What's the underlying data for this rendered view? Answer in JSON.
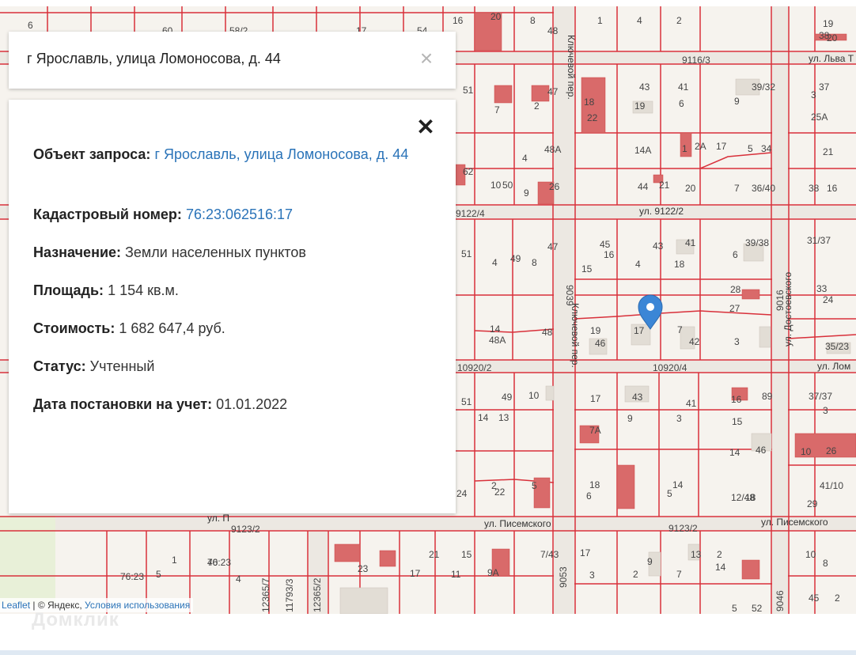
{
  "search": {
    "query": "г Ярославль, улица Ломоносова, д. 44",
    "clear_icon": "×"
  },
  "info": {
    "close_icon": "✕",
    "object_label": "Объект запроса:",
    "object_value": "г Ярославль, улица Ломоносова, д. 44",
    "cadastral_label": "Кадастровый номер:",
    "cadastral_value": "76:23:062516:17",
    "purpose_label": "Назначение:",
    "purpose_value": "Земли населенных пунктов",
    "area_label": "Площадь:",
    "area_value": "1 154 кв.м.",
    "cost_label": "Стоимость:",
    "cost_value": "1 682 647,4 руб.",
    "status_label": "Статус:",
    "status_value": "Учтенный",
    "date_label": "Дата постановки на учет:",
    "date_value": "01.01.2022"
  },
  "map": {
    "streets": {
      "lva_tolstogo": "ул. Льва Т",
      "ul_9122": "ул. 9122/2",
      "lomonosova": "ул. Лом",
      "pisemskogo_1": "ул. Писемского",
      "pisemskogo_2": "ул. Писемского",
      "pisemskogo_3": "ул. П",
      "klyuchevoy_1": "Ключевой пер.",
      "klyuchevoy_2": "Ключевой пер.",
      "dostoevskogo": "ул. Достоевского"
    },
    "codes": [
      "9116/3",
      "9122/4",
      "10920/2",
      "10920/4",
      "9123/2",
      "9123/2",
      "9039",
      "9016",
      "9053",
      "9046",
      "12365/7",
      "11793/3",
      "12365/2",
      "76:23"
    ],
    "house_numbers": [
      "6",
      "60",
      "58/2",
      "17",
      "54",
      "16",
      "20",
      "8",
      "48",
      "1",
      "4",
      "2",
      "19",
      "38",
      "20",
      "43",
      "41",
      "39/32",
      "37",
      "51",
      "7",
      "2",
      "47",
      "18",
      "22",
      "19",
      "6",
      "9",
      "3",
      "25А",
      "48А",
      "4",
      "14А",
      "1",
      "2А",
      "17",
      "5",
      "34",
      "21",
      "62",
      "10",
      "50",
      "9",
      "26",
      "44",
      "21",
      "20",
      "7",
      "36/40",
      "38",
      "16",
      "45",
      "16",
      "43",
      "41",
      "39/38",
      "31/37",
      "51",
      "4",
      "49",
      "8",
      "47",
      "15",
      "4",
      "18",
      "6",
      "28",
      "33",
      "24",
      "27",
      "14",
      "48А",
      "48",
      "19",
      "46",
      "17",
      "7",
      "42",
      "3",
      "35/23",
      "51",
      "49",
      "14",
      "13",
      "10",
      "17",
      "43",
      "41",
      "16",
      "89",
      "37/37",
      "3",
      "15",
      "7А",
      "9",
      "3",
      "14",
      "46",
      "10",
      "26",
      "24",
      "2",
      "22",
      "5",
      "18",
      "6",
      "14",
      "5",
      "12/48",
      "18",
      "41/10",
      "29",
      "1",
      "5",
      "76:23",
      "40",
      "4",
      "23",
      "21",
      "17",
      "15",
      "11",
      "9А",
      "7/43",
      "17",
      "3",
      "2",
      "9",
      "7",
      "13",
      "2",
      "14",
      "10",
      "8",
      "5",
      "52",
      "45",
      "2"
    ],
    "marker_icon": "map-pin"
  },
  "attribution": {
    "leaflet": "Leaflet",
    "separator": " | © Яндекс, ",
    "terms": "Условия использования"
  },
  "watermark": "Домклик",
  "colors": {
    "boundary": "#d8303a",
    "building": "#d96a6a",
    "marker": "#3b86d6",
    "link": "#2a73b8"
  }
}
